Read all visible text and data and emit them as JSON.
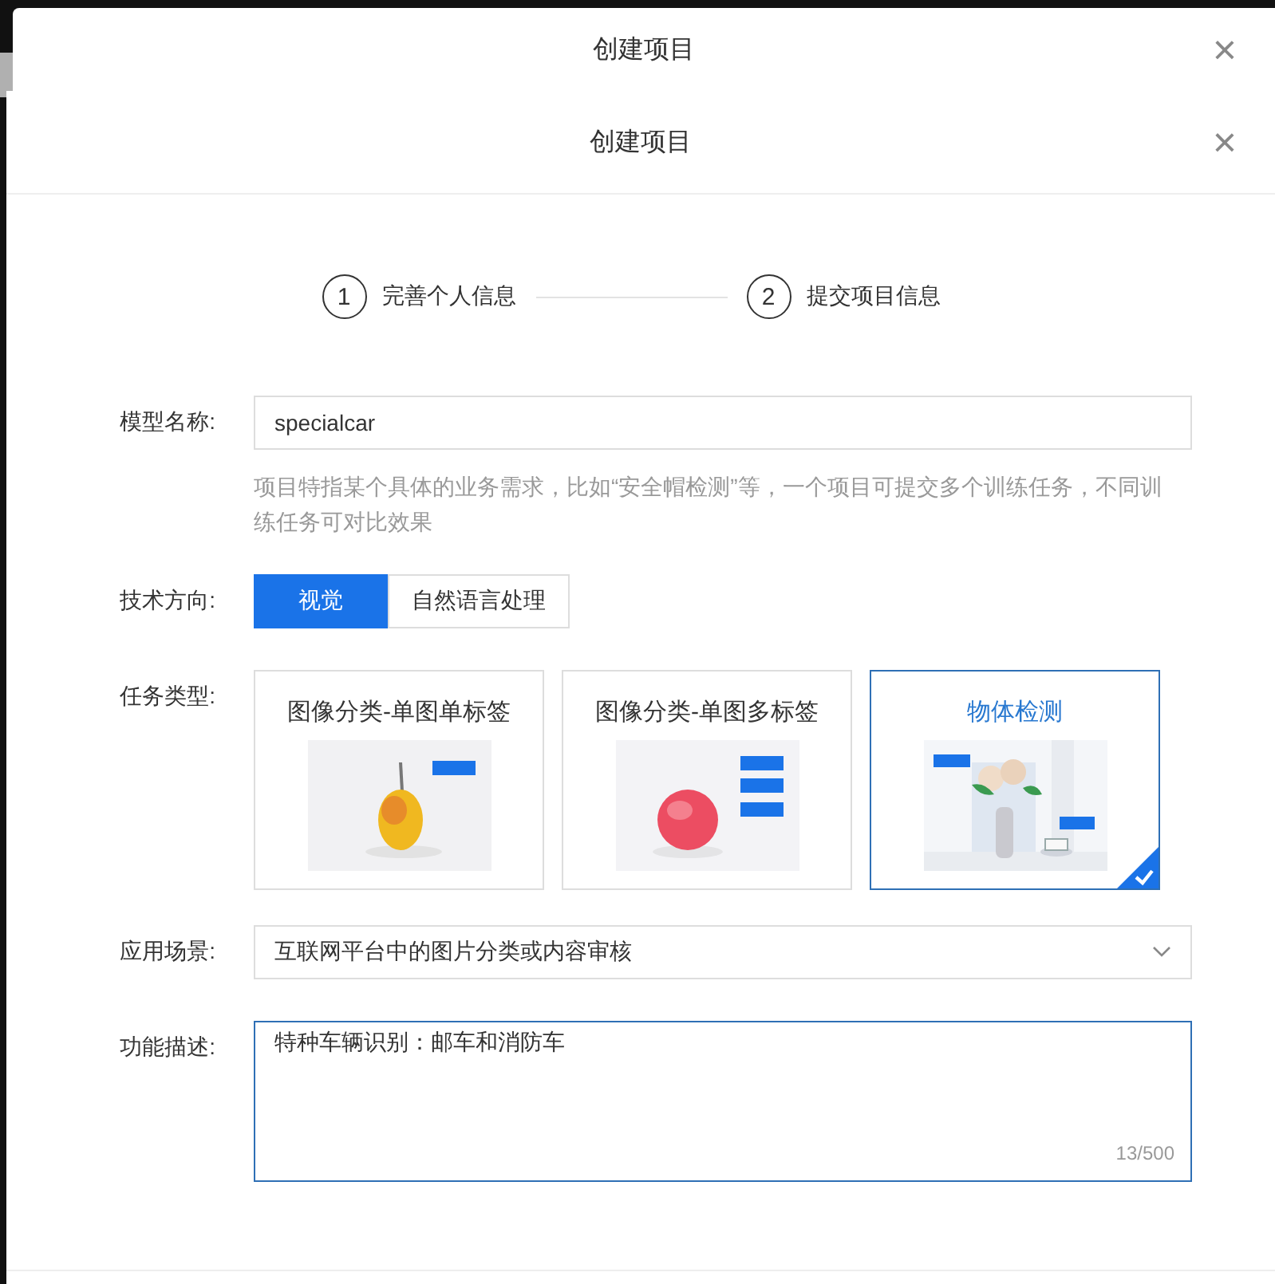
{
  "background_dialog": {
    "title": "创建项目",
    "close": "×"
  },
  "dialog": {
    "title": "创建项目",
    "close": "×"
  },
  "steps": [
    {
      "number": "1",
      "label": "完善个人信息"
    },
    {
      "number": "2",
      "label": "提交项目信息"
    }
  ],
  "form": {
    "model_name": {
      "label": "模型名称:",
      "value": "specialcar",
      "hint": "项目特指某个具体的业务需求，比如“安全帽检测”等，一个项目可提交多个训练任务，不同训练任务可对比效果"
    },
    "tech_direction": {
      "label": "技术方向:",
      "options": [
        {
          "label": "视觉",
          "selected": true
        },
        {
          "label": "自然语言处理",
          "selected": false
        }
      ]
    },
    "task_type": {
      "label": "任务类型:",
      "options": [
        {
          "title": "图像分类-单图单标签",
          "selected": false
        },
        {
          "title": "图像分类-单图多标签",
          "selected": false
        },
        {
          "title": "物体检测",
          "selected": true
        }
      ]
    },
    "scenario": {
      "label": "应用场景:",
      "value": "互联网平台中的图片分类或内容审核"
    },
    "description": {
      "label": "功能描述:",
      "value": "特种车辆识别：邮车和消防车",
      "counter": "13/500"
    }
  }
}
